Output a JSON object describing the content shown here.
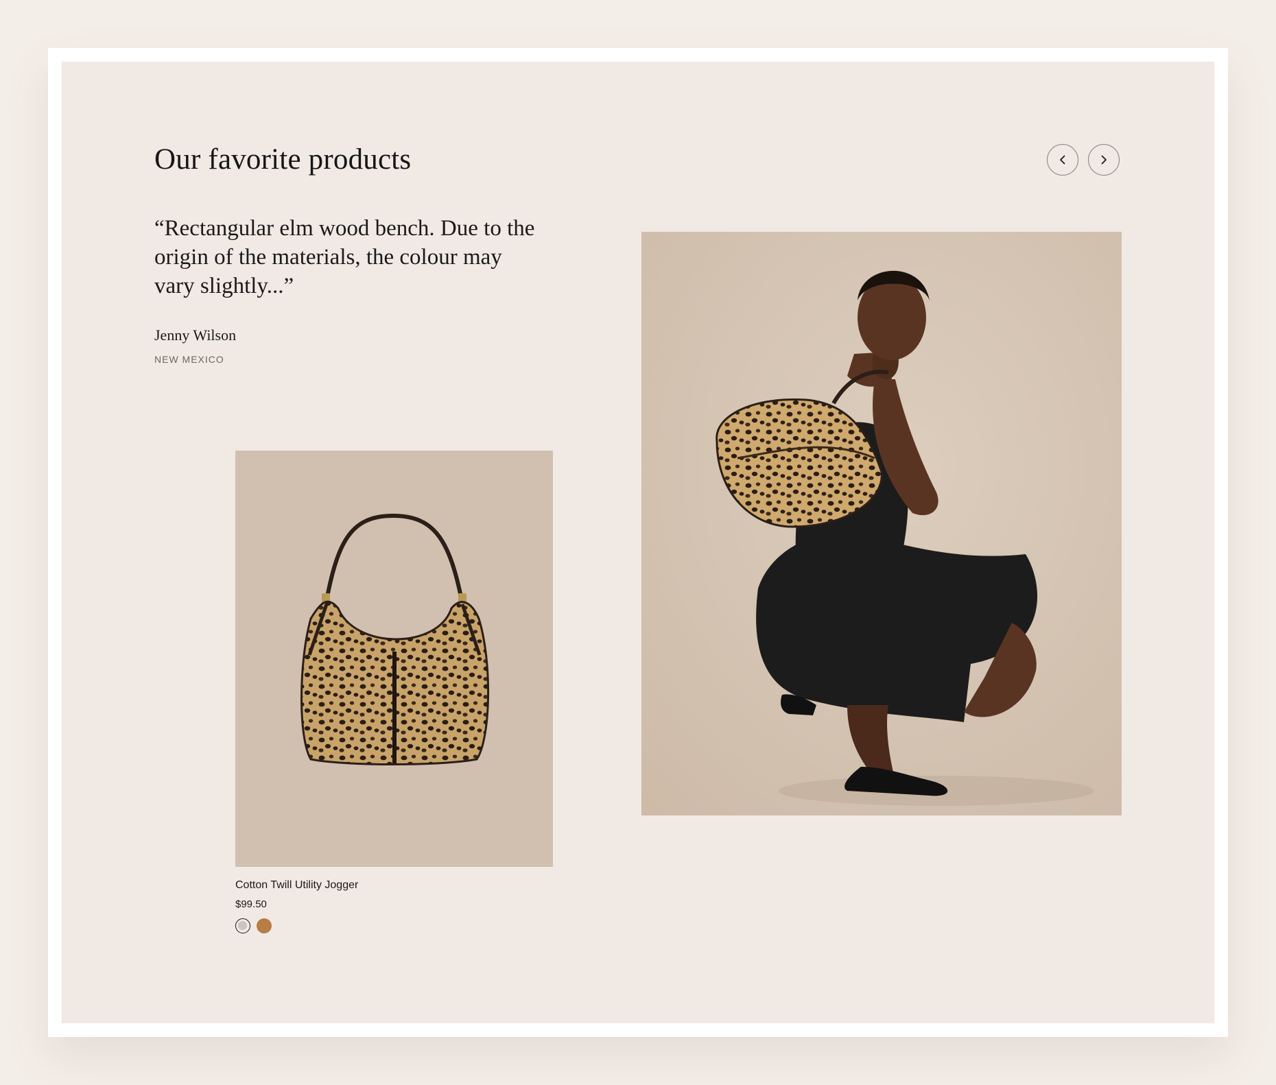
{
  "section": {
    "title": "Our favorite products"
  },
  "carousel": {
    "prev_icon": "chevron-left-icon",
    "next_icon": "chevron-right-icon"
  },
  "testimonial": {
    "quote": "“Rectangular elm wood bench. Due to the origin of the materials, the colour may vary slightly...”",
    "author": "Jenny Wilson",
    "location": "NEW MEXICO"
  },
  "product": {
    "name": "Cotton Twill Utility Jogger",
    "price": "$99.50",
    "swatches": [
      {
        "color": "#c9c6c1",
        "selected": true
      },
      {
        "color": "#b87d45",
        "selected": false
      }
    ]
  },
  "colors": {
    "page_bg": "#f4eee8",
    "panel_bg": "#f1e9e3",
    "product_bg": "#d1c0b0",
    "lifestyle_bg": "#d7c7b6"
  }
}
